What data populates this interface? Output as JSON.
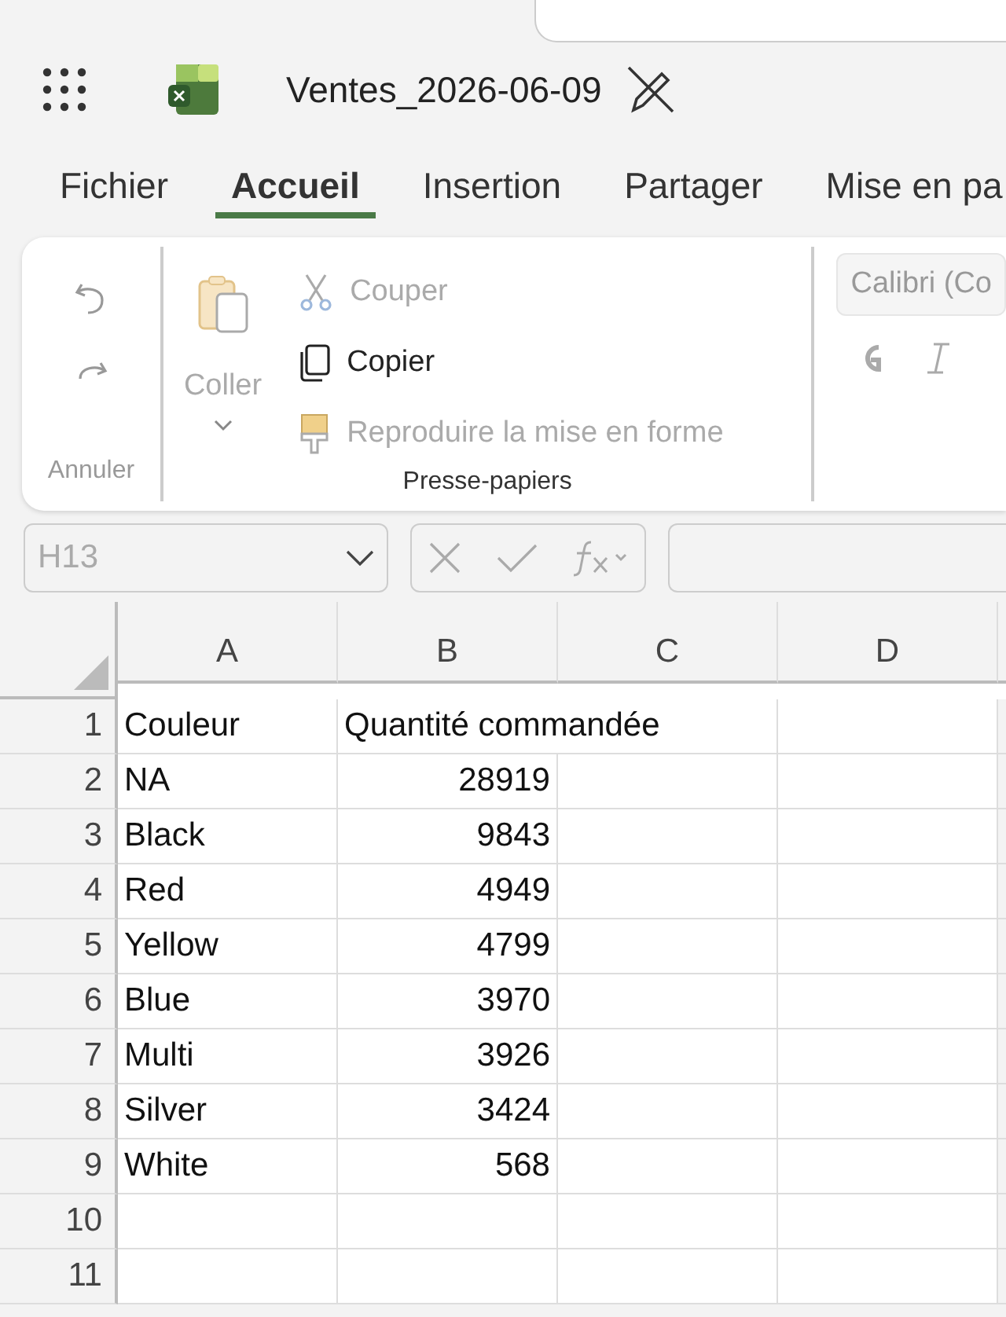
{
  "window": {
    "title": "Ventes_2026-06-09"
  },
  "tabs": [
    {
      "label": "Fichier",
      "selected": false
    },
    {
      "label": "Accueil",
      "selected": true
    },
    {
      "label": "Insertion",
      "selected": false
    },
    {
      "label": "Partager",
      "selected": false
    },
    {
      "label": "Mise en pa",
      "selected": false
    }
  ],
  "ribbon": {
    "undo": {
      "label": "Annuler",
      "disabled": true
    },
    "clipboard": {
      "label": "Presse-papiers",
      "paste": {
        "label": "Coller",
        "disabled": true
      },
      "items": [
        {
          "kind": "cut",
          "label": "Couper",
          "disabled": true
        },
        {
          "kind": "copy",
          "label": "Copier",
          "disabled": false
        },
        {
          "kind": "format",
          "label": "Reproduire la mise en forme",
          "disabled": true
        }
      ]
    },
    "font": {
      "name": "Calibri (Co"
    }
  },
  "formula_bar": {
    "cell_ref": "H13"
  },
  "sheet": {
    "columns": [
      "A",
      "B",
      "C",
      "D"
    ],
    "rows": [
      {
        "n": "1",
        "cells": [
          "Couleur",
          "Quantité commandée",
          "",
          ""
        ]
      },
      {
        "n": "2",
        "cells": [
          "NA",
          "28919",
          "",
          ""
        ]
      },
      {
        "n": "3",
        "cells": [
          "Black",
          "9843",
          "",
          ""
        ]
      },
      {
        "n": "4",
        "cells": [
          "Red",
          "4949",
          "",
          ""
        ]
      },
      {
        "n": "5",
        "cells": [
          "Yellow",
          "4799",
          "",
          ""
        ]
      },
      {
        "n": "6",
        "cells": [
          "Blue",
          "3970",
          "",
          ""
        ]
      },
      {
        "n": "7",
        "cells": [
          "Multi",
          "3926",
          "",
          ""
        ]
      },
      {
        "n": "8",
        "cells": [
          "Silver",
          "3424",
          "",
          ""
        ]
      },
      {
        "n": "9",
        "cells": [
          "White",
          "568",
          "",
          ""
        ]
      },
      {
        "n": "10",
        "cells": [
          "",
          "",
          "",
          ""
        ]
      },
      {
        "n": "11",
        "cells": [
          "",
          "",
          "",
          ""
        ]
      }
    ]
  }
}
